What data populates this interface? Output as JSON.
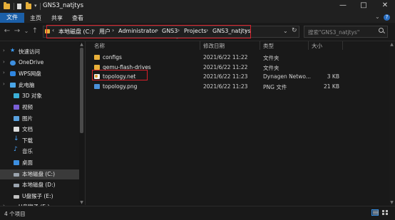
{
  "window": {
    "title": "GNS3_natjtys",
    "controls": [
      "—",
      "□",
      "✕"
    ]
  },
  "ribbon": {
    "tabs": [
      "文件",
      "主页",
      "共享",
      "查看"
    ],
    "collapse_glyph": "⌄",
    "help_glyph": "?"
  },
  "nav": {
    "back": "←",
    "forward": "→",
    "recent": "⌄",
    "up": "↑",
    "breadcrumb": [
      "本地磁盘 (C:)",
      "用户",
      "Administrator",
      "GNS3",
      "Projects",
      "GNS3_natjtys"
    ],
    "crumb_sep": "›",
    "history_dropdown": "⌄",
    "refresh": "↻"
  },
  "search": {
    "placeholder": "搜索\"GNS3_natjtys\""
  },
  "sidebar": {
    "items": [
      {
        "label": "快速访问",
        "icon": "star-icon",
        "indent": 0
      },
      {
        "label": "OneDrive",
        "icon": "cloud-icon",
        "indent": 0
      },
      {
        "label": "WPS网盘",
        "icon": "wps-cloud-icon",
        "indent": 0
      },
      {
        "label": "此电脑",
        "icon": "computer-icon",
        "indent": 0
      },
      {
        "label": "3D 对象",
        "icon": "3d-objects-icon",
        "indent": 1
      },
      {
        "label": "视频",
        "icon": "video-icon",
        "indent": 1
      },
      {
        "label": "图片",
        "icon": "pictures-icon",
        "indent": 1
      },
      {
        "label": "文档",
        "icon": "documents-icon",
        "indent": 1
      },
      {
        "label": "下载",
        "icon": "download-icon",
        "indent": 1
      },
      {
        "label": "音乐",
        "icon": "music-icon",
        "indent": 1
      },
      {
        "label": "桌面",
        "icon": "desktop-icon",
        "indent": 1
      },
      {
        "label": "本地磁盘 (C:)",
        "icon": "drive-icon",
        "indent": 1,
        "selected": true
      },
      {
        "label": "本地磁盘 (D:)",
        "icon": "drive-icon",
        "indent": 1
      },
      {
        "label": "U盘猴子 (E:)",
        "icon": "usb-drive-icon",
        "indent": 1
      },
      {
        "label": "U盘猴子 (E:)",
        "icon": "usb-drive-icon",
        "indent": 0
      }
    ]
  },
  "columns": {
    "name": "名称",
    "date": "修改日期",
    "type": "类型",
    "size": "大小"
  },
  "files": [
    {
      "name": "configs",
      "date": "2021/6/22 11:22",
      "type": "文件夹",
      "size": "",
      "icon": "folder-icon"
    },
    {
      "name": "qemu-flash-drives",
      "date": "2021/6/22 11:22",
      "type": "文件夹",
      "size": "",
      "icon": "folder-icon"
    },
    {
      "name": "topology.net",
      "date": "2021/6/22 11:23",
      "type": "Dynagen Netwo...",
      "size": "3 KB",
      "icon": "net-file-icon"
    },
    {
      "name": "topology.png",
      "date": "2021/6/22 11:23",
      "type": "PNG 文件",
      "size": "21 KB",
      "icon": "image-file-icon"
    }
  ],
  "status": {
    "count": "4 个项目"
  },
  "colors": {
    "highlight": "#d8202a",
    "accent": "#1b5fa8",
    "background": "#191919"
  }
}
